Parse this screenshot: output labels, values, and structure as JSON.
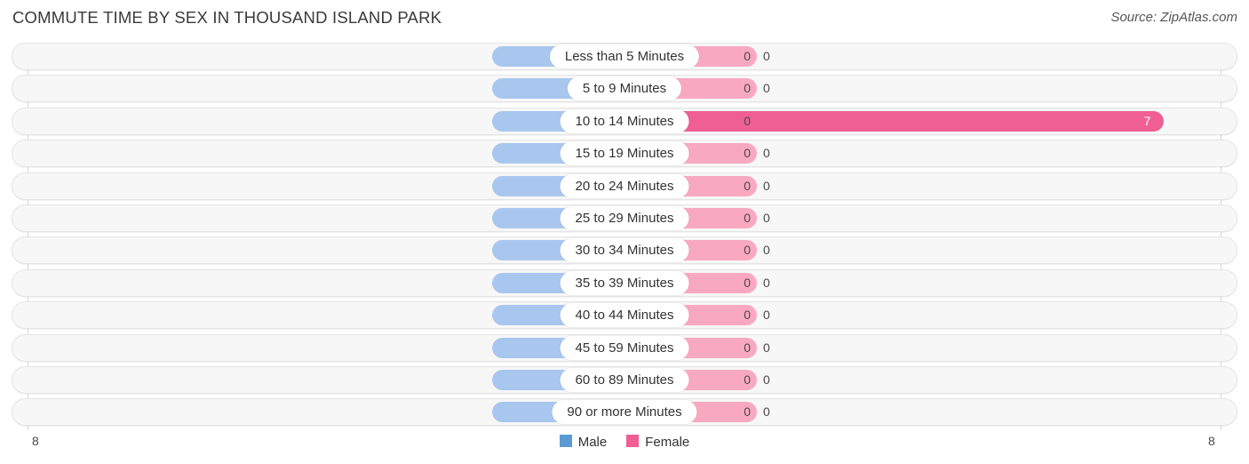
{
  "header": {
    "title": "COMMUTE TIME BY SEX IN THOUSAND ISLAND PARK",
    "source": "Source: ZipAtlas.com"
  },
  "axis": {
    "left_label": "8",
    "right_label": "8",
    "max": 8
  },
  "legend": {
    "items": [
      {
        "label": "Male",
        "color": "#5b9bd5"
      },
      {
        "label": "Female",
        "color": "#ef5f92"
      }
    ]
  },
  "colors": {
    "male_bar": "#a9c7ee",
    "female_bar": "#f9a8c2",
    "female_bar_highlight": "#ef5f92",
    "track": "#f7f7f7",
    "track_border": "#e4e4e4",
    "gridline": "#d8d8d8"
  },
  "chart_data": {
    "type": "bar",
    "orientation": "horizontal-diverging",
    "title": "COMMUTE TIME BY SEX IN THOUSAND ISLAND PARK",
    "xlabel": "",
    "ylabel": "",
    "xlim": [
      8,
      8
    ],
    "grid": true,
    "legend_position": "bottom-center",
    "categories": [
      "Less than 5 Minutes",
      "5 to 9 Minutes",
      "10 to 14 Minutes",
      "15 to 19 Minutes",
      "20 to 24 Minutes",
      "25 to 29 Minutes",
      "30 to 34 Minutes",
      "35 to 39 Minutes",
      "40 to 44 Minutes",
      "45 to 59 Minutes",
      "60 to 89 Minutes",
      "90 or more Minutes"
    ],
    "series": [
      {
        "name": "Male",
        "values": [
          0,
          0,
          0,
          0,
          0,
          0,
          0,
          0,
          0,
          0,
          0,
          0
        ]
      },
      {
        "name": "Female",
        "values": [
          0,
          0,
          7,
          0,
          0,
          0,
          0,
          0,
          0,
          0,
          0,
          0
        ]
      }
    ]
  },
  "rows": [
    {
      "category": "Less than 5 Minutes",
      "male": "0",
      "female": "0"
    },
    {
      "category": "5 to 9 Minutes",
      "male": "0",
      "female": "0"
    },
    {
      "category": "10 to 14 Minutes",
      "male": "0",
      "female": "7"
    },
    {
      "category": "15 to 19 Minutes",
      "male": "0",
      "female": "0"
    },
    {
      "category": "20 to 24 Minutes",
      "male": "0",
      "female": "0"
    },
    {
      "category": "25 to 29 Minutes",
      "male": "0",
      "female": "0"
    },
    {
      "category": "30 to 34 Minutes",
      "male": "0",
      "female": "0"
    },
    {
      "category": "35 to 39 Minutes",
      "male": "0",
      "female": "0"
    },
    {
      "category": "40 to 44 Minutes",
      "male": "0",
      "female": "0"
    },
    {
      "category": "45 to 59 Minutes",
      "male": "0",
      "female": "0"
    },
    {
      "category": "60 to 89 Minutes",
      "male": "0",
      "female": "0"
    },
    {
      "category": "90 or more Minutes",
      "male": "0",
      "female": "0"
    }
  ]
}
